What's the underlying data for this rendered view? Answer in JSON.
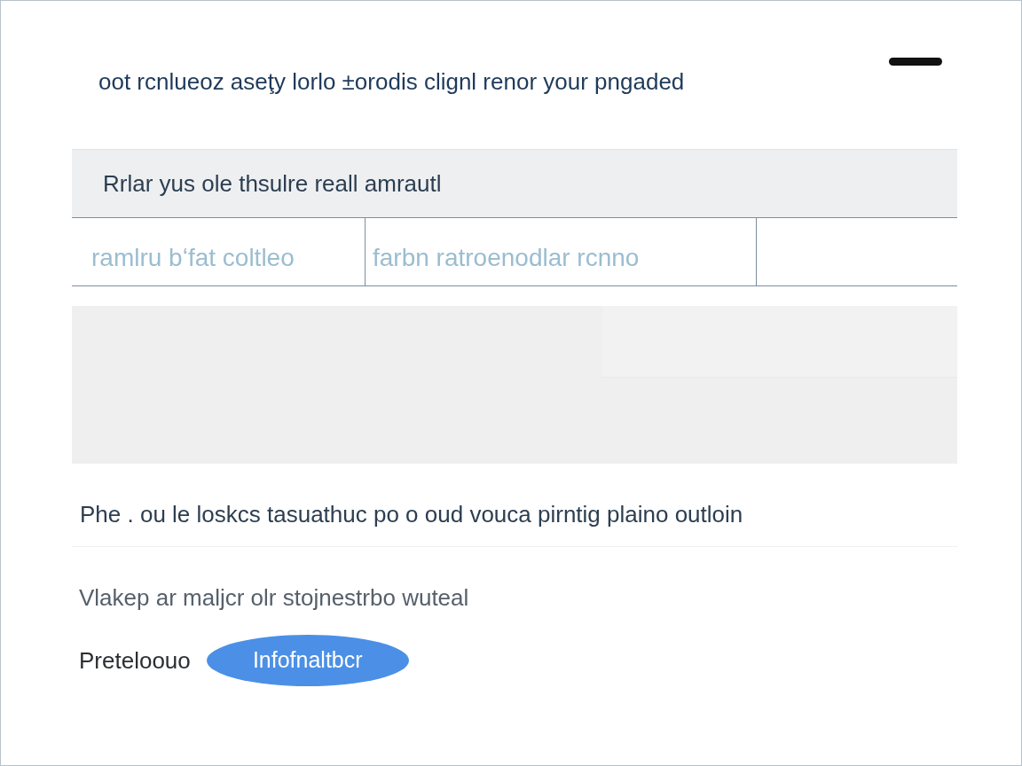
{
  "heading": "oot rcnlueoz aseţy lorlo ±orodis clignl renor your pngaded",
  "banner": "Rrlar yus ole thsulre reall amrautl",
  "cells": [
    "ramlru bʻfat coltleo",
    "farbn ratroenodlar rcnno"
  ],
  "paragraph": "Phe . ou le loskcs tasuathuc po o oud vouca pirntig plaino outloin",
  "note": "Vlakep ar  maljcr olr stojnestrbo wuteal",
  "label": "Preteloouo",
  "button": "Infofnaltbcr"
}
